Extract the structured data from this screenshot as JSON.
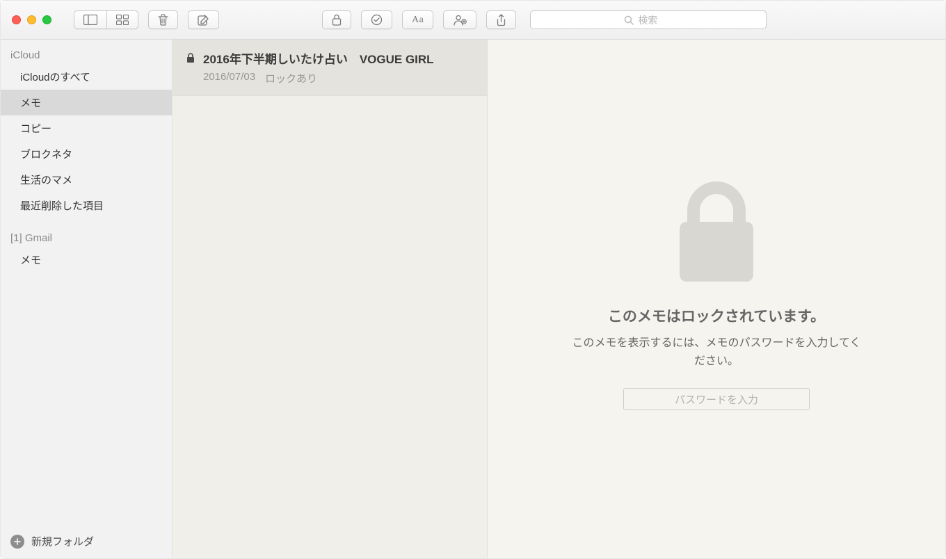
{
  "search": {
    "placeholder": "検索"
  },
  "sidebar": {
    "sections": [
      {
        "header": "iCloud",
        "items": [
          {
            "label": "iCloudのすべて",
            "selected": false
          },
          {
            "label": "メモ",
            "selected": true
          },
          {
            "label": "コピー",
            "selected": false
          },
          {
            "label": "ブロクネタ",
            "selected": false
          },
          {
            "label": "生活のマメ",
            "selected": false
          },
          {
            "label": "最近削除した項目",
            "selected": false
          }
        ]
      },
      {
        "header": "[1] Gmail",
        "items": [
          {
            "label": "メモ",
            "selected": false
          }
        ]
      }
    ],
    "new_folder_label": "新規フォルダ"
  },
  "notes": {
    "items": [
      {
        "locked": true,
        "title": "2016年下半期しいたけ占い　VOGUE GIRL",
        "date": "2016/07/03",
        "status": "ロックあり"
      }
    ]
  },
  "locked_view": {
    "heading": "このメモはロックされています。",
    "subtext": "このメモを表示するには、メモのパスワードを入力してください。",
    "button_label": "パスワードを入力"
  },
  "icons": {
    "sidebar_toggle": "sidebar-toggle",
    "grid": "grid",
    "trash": "trash",
    "compose": "compose",
    "lock": "lock",
    "checklist": "checklist",
    "text_style": "Aa",
    "add_person": "add-person",
    "share": "share"
  }
}
